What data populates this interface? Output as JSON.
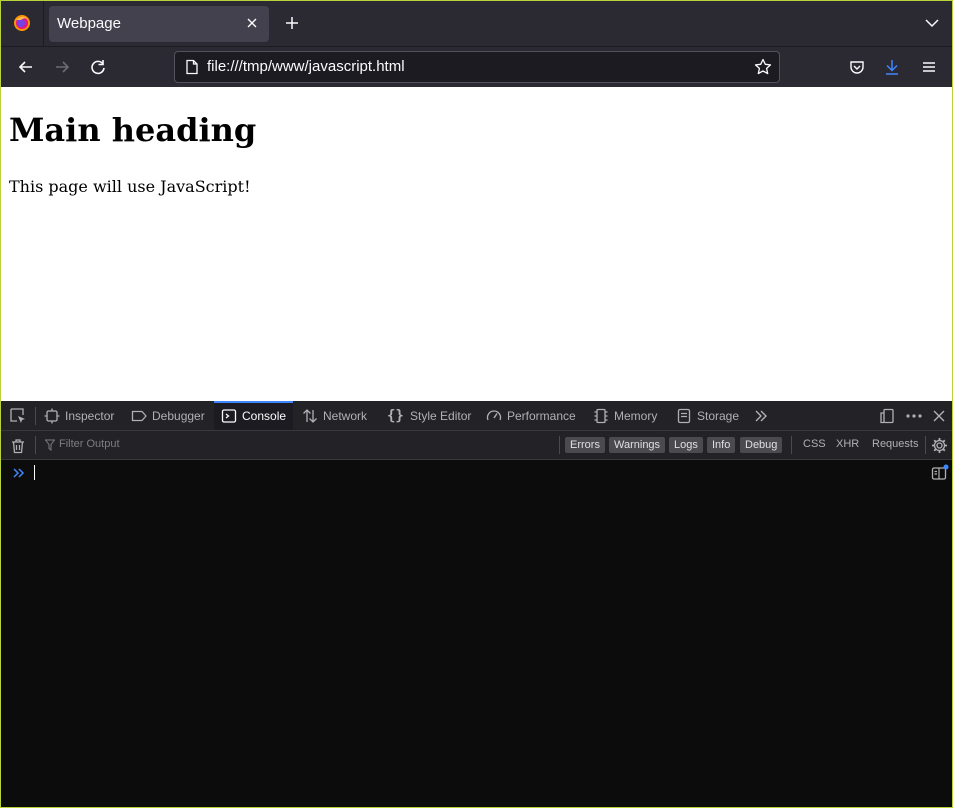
{
  "browser": {
    "tab_title": "Webpage",
    "url": "file:///tmp/www/javascript.html"
  },
  "page": {
    "heading": "Main heading",
    "paragraph": "This page will use JavaScript!"
  },
  "devtools": {
    "tabs": [
      {
        "label": "Inspector",
        "icon": "inspector-icon"
      },
      {
        "label": "Debugger",
        "icon": "debugger-icon"
      },
      {
        "label": "Console",
        "icon": "console-icon",
        "active": true
      },
      {
        "label": "Network",
        "icon": "network-icon"
      },
      {
        "label": "Style Editor",
        "icon": "style-editor-icon"
      },
      {
        "label": "Performance",
        "icon": "performance-icon"
      },
      {
        "label": "Memory",
        "icon": "memory-icon"
      },
      {
        "label": "Storage",
        "icon": "storage-icon"
      }
    ],
    "accent_color": "#3f87ff",
    "console": {
      "filter_placeholder": "Filter Output",
      "levels": [
        "Errors",
        "Warnings",
        "Logs",
        "Info",
        "Debug"
      ],
      "net_filters": [
        "CSS",
        "XHR",
        "Requests"
      ]
    }
  }
}
